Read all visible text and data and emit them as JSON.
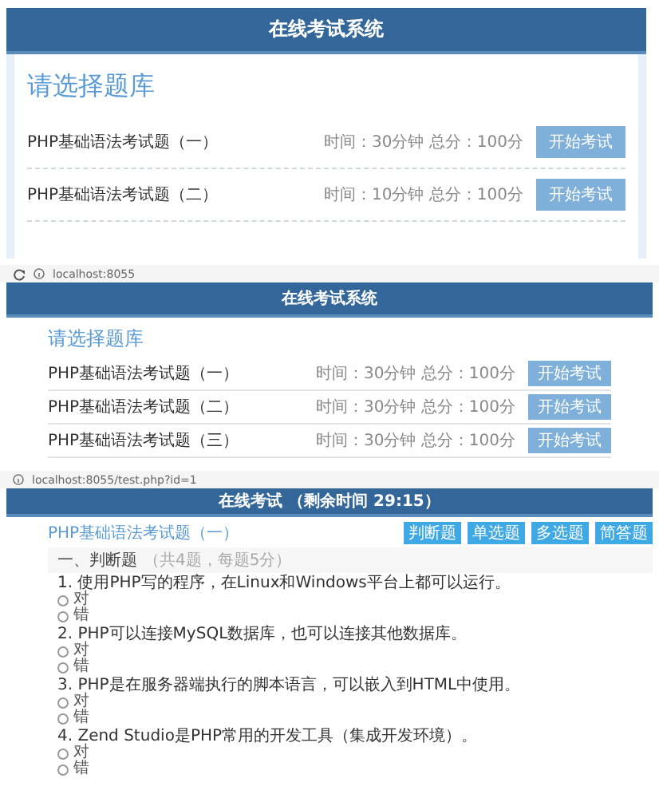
{
  "screens": [
    {
      "kind": "list",
      "header": "在线考试系统",
      "heading": "请选择题库",
      "exams": [
        {
          "name": "PHP基础语法考试题（一）",
          "meta": "时间：30分钟 总分：100分",
          "button": "开始考试"
        },
        {
          "name": "PHP基础语法考试题（二）",
          "meta": "时间：10分钟 总分：100分",
          "button": "开始考试"
        }
      ]
    },
    {
      "kind": "list",
      "address": "localhost:8055",
      "header": "在线考试系统",
      "heading": "请选择题库",
      "exams": [
        {
          "name": "PHP基础语法考试题（一）",
          "meta": "时间：30分钟 总分：100分",
          "button": "开始考试"
        },
        {
          "name": "PHP基础语法考试题（二）",
          "meta": "时间：30分钟 总分：100分",
          "button": "开始考试"
        },
        {
          "name": "PHP基础语法考试题（三）",
          "meta": "时间：30分钟 总分：100分",
          "button": "开始考试"
        }
      ]
    },
    {
      "kind": "exam",
      "address": "localhost:8055/test.php?id=1",
      "header": "在线考试 （剩余时间 29:15）",
      "heading": "PHP基础语法考试题（一）",
      "nav": [
        "判断题",
        "单选题",
        "多选题",
        "简答题"
      ],
      "section": {
        "title": "一、判断题",
        "note": "（共4题，每题5分）"
      },
      "questions": [
        {
          "text": "1. 使用PHP写的程序，在Linux和Windows平台上都可以运行。",
          "options": [
            {
              "label": "对",
              "selected": false
            },
            {
              "label": "错",
              "selected": false
            }
          ]
        },
        {
          "text": "2. PHP可以连接MySQL数据库，也可以连接其他数据库。",
          "options": [
            {
              "label": "对",
              "selected": false
            },
            {
              "label": "错",
              "selected": false
            }
          ]
        },
        {
          "text": "3. PHP是在服务器端执行的脚本语言，可以嵌入到HTML中使用。",
          "options": [
            {
              "label": "对",
              "selected": false
            },
            {
              "label": "错",
              "selected": false
            }
          ]
        },
        {
          "text": "4. Zend Studio是PHP常用的开发工具（集成开发环境）。",
          "options": [
            {
              "label": "对",
              "selected": false
            },
            {
              "label": "错",
              "selected": false
            }
          ]
        }
      ]
    }
  ]
}
